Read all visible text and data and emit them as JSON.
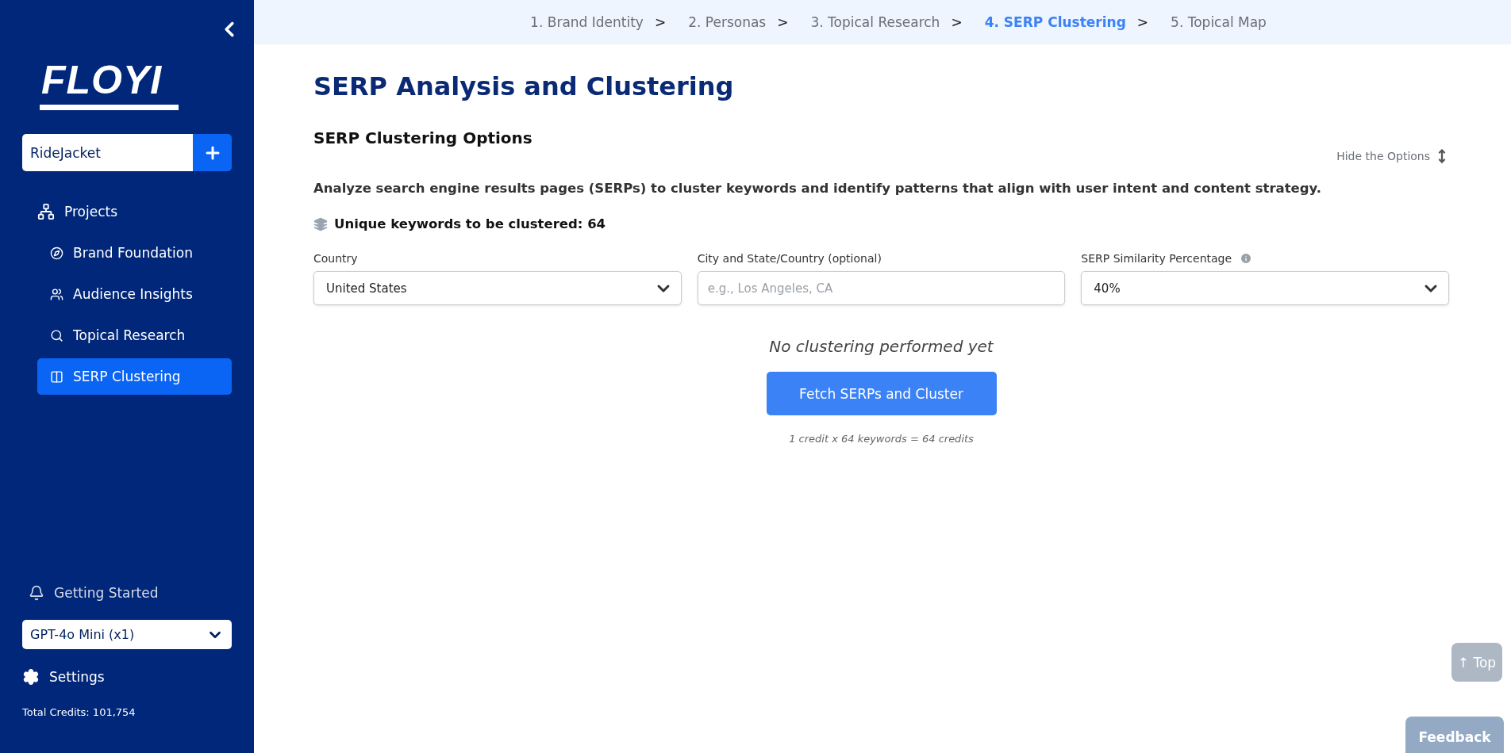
{
  "sidebar": {
    "logo": "FLOYI",
    "project": {
      "value": "RideJacket"
    },
    "nav": [
      {
        "label": "Projects",
        "kind": "projects",
        "selected": false,
        "children": [
          {
            "label": "Brand Foundation",
            "kind": "compass",
            "selected": false
          },
          {
            "label": "Audience Insights",
            "kind": "users",
            "selected": false
          },
          {
            "label": "Topical Research",
            "kind": "search",
            "selected": false
          },
          {
            "label": "SERP Clustering",
            "kind": "columns",
            "selected": true
          }
        ]
      }
    ],
    "getting_started": "Getting Started",
    "model": {
      "value": "GPT-4o Mini (x1)"
    },
    "settings": "Settings",
    "credits": "Total Credits: 101,754"
  },
  "steps": [
    {
      "label": "1. Brand Identity",
      "selected": false
    },
    {
      "label": "2. Personas",
      "selected": false
    },
    {
      "label": "3. Topical Research",
      "selected": false
    },
    {
      "label": "4. SERP Clustering",
      "selected": true
    },
    {
      "label": "5. Topical Map",
      "selected": false
    }
  ],
  "step_separator": ">",
  "page": {
    "title": "SERP Analysis and Clustering",
    "section_title": "SERP Clustering Options",
    "hide_options": "Hide the Options",
    "description": "Analyze search engine results pages (SERPs) to cluster keywords and identify patterns that align with user intent and content strategy.",
    "keyword_count": "Unique keywords to be clustered: 64",
    "fields": [
      {
        "label": "Country",
        "kind": "select",
        "value": "United States",
        "info": false
      },
      {
        "label": "City and State/Country (optional)",
        "kind": "text",
        "placeholder": "e.g., Los Angeles, CA",
        "info": false
      },
      {
        "label": "SERP Similarity Percentage",
        "kind": "select",
        "value": "40%",
        "info": true
      }
    ],
    "empty_message": "No clustering performed yet",
    "action": "Fetch SERPs and Cluster",
    "cost_note": "1 credit x 64 keywords = 64 credits"
  },
  "top_button": "↑ Top",
  "feedback_button": "Feedback"
}
